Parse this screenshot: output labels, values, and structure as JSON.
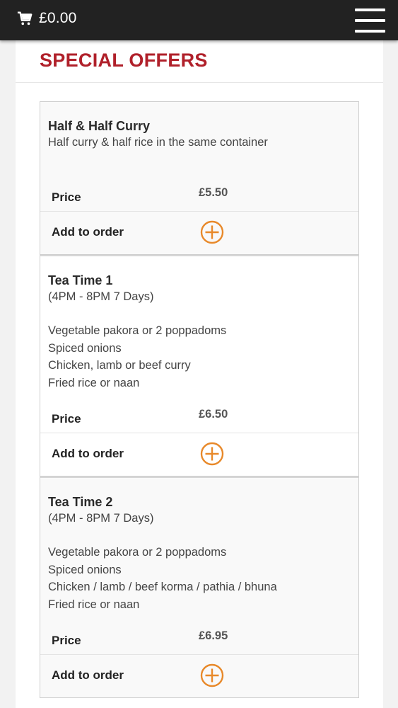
{
  "header": {
    "cart_total": "£0.00",
    "cart_icon": "shopping-cart-icon",
    "menu_icon": "hamburger-menu-icon",
    "background_color": "#222222"
  },
  "section": {
    "title": "SPECIAL OFFERS",
    "title_color": "#b0202a"
  },
  "offers": [
    {
      "name": "Half & Half Curry",
      "subtitle": "Half curry & half rice in the same container",
      "lines": [],
      "price_label": "Price",
      "price": "£5.50",
      "add_label": "Add to order"
    },
    {
      "name": "Tea Time 1",
      "subtitle": "(4PM - 8PM 7 Days)",
      "lines": [
        "Vegetable pakora or 2 poppadoms",
        "Spiced onions",
        "Chicken, lamb or beef curry",
        "Fried rice or naan"
      ],
      "price_label": "Price",
      "price": "£6.50",
      "add_label": "Add to order"
    },
    {
      "name": "Tea Time 2",
      "subtitle": "(4PM - 8PM 7 Days)",
      "lines": [
        "Vegetable pakora or 2 poppadoms",
        "Spiced onions",
        "Chicken / lamb / beef korma / pathia / bhuna",
        "Fried rice or naan"
      ],
      "price_label": "Price",
      "price": "£6.95",
      "add_label": "Add to order"
    }
  ],
  "colors": {
    "accent_orange": "#e8892a"
  }
}
